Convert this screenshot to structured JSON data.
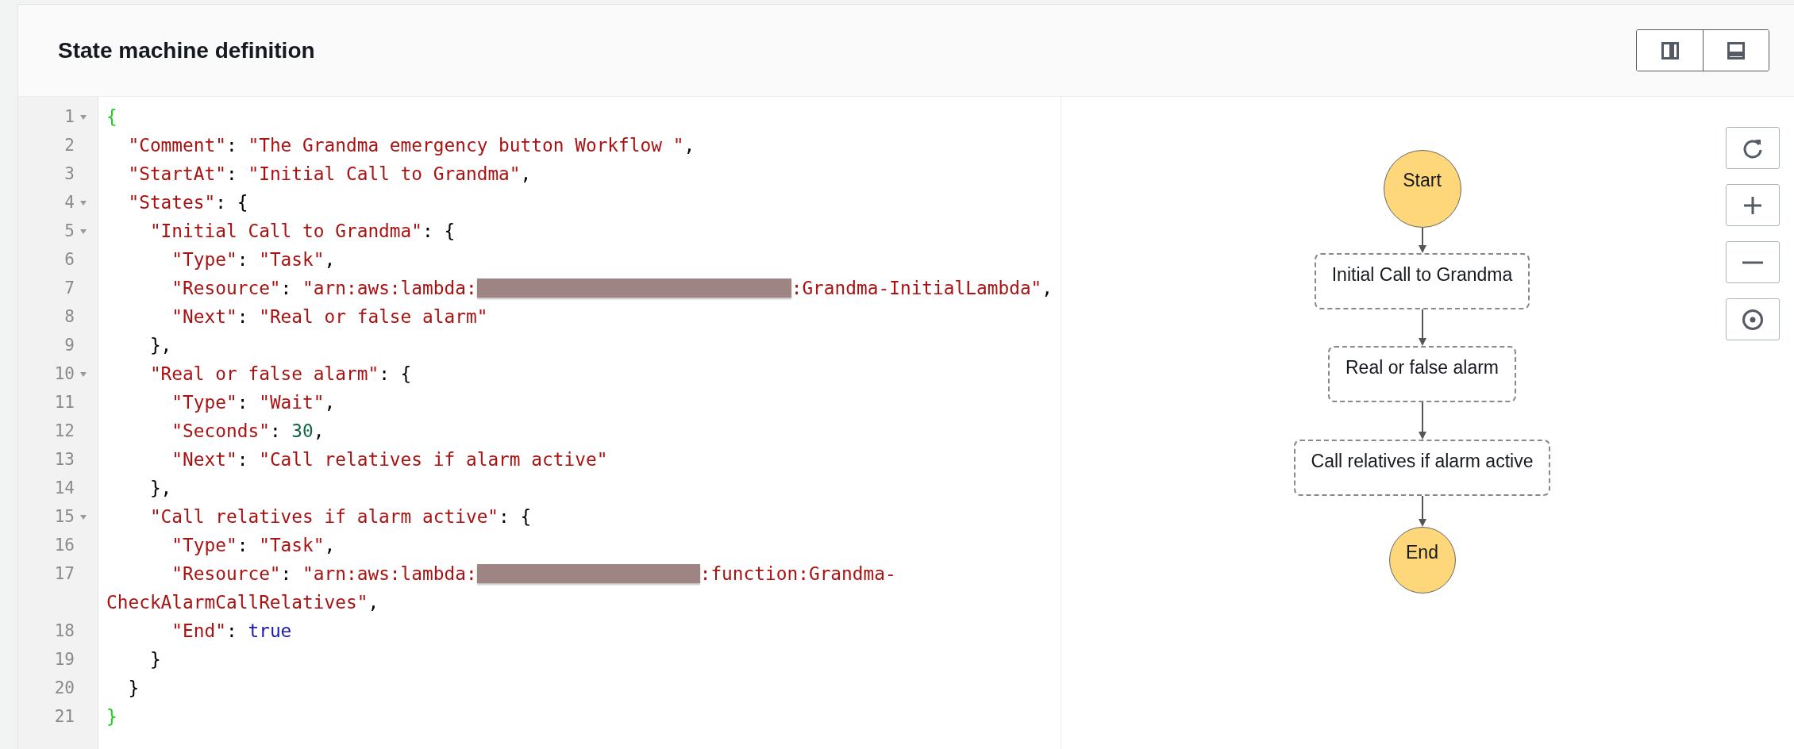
{
  "panel": {
    "title": "State machine definition"
  },
  "layout_buttons": [
    {
      "kind": "columns",
      "selected": false
    },
    {
      "kind": "rows",
      "selected": false
    }
  ],
  "code": {
    "lines": [
      {
        "number": "1",
        "foldable": true,
        "tokens": [
          {
            "kind": "brace",
            "text": "{"
          }
        ]
      },
      {
        "number": "2",
        "foldable": false,
        "tokens": [
          {
            "kind": "string",
            "text": "  \"Comment\""
          },
          {
            "kind": "punct",
            "text": ": "
          },
          {
            "kind": "string",
            "text": "\"The Grandma emergency button Workflow \""
          },
          {
            "kind": "punct",
            "text": ","
          }
        ]
      },
      {
        "number": "3",
        "foldable": false,
        "tokens": [
          {
            "kind": "string",
            "text": "  \"StartAt\""
          },
          {
            "kind": "punct",
            "text": ": "
          },
          {
            "kind": "string",
            "text": "\"Initial Call to Grandma\""
          },
          {
            "kind": "punct",
            "text": ","
          }
        ]
      },
      {
        "number": "4",
        "foldable": true,
        "tokens": [
          {
            "kind": "string",
            "text": "  \"States\""
          },
          {
            "kind": "punct",
            "text": ": {"
          }
        ]
      },
      {
        "number": "5",
        "foldable": true,
        "tokens": [
          {
            "kind": "string",
            "text": "    \"Initial Call to Grandma\""
          },
          {
            "kind": "punct",
            "text": ": {"
          }
        ]
      },
      {
        "number": "6",
        "foldable": false,
        "tokens": [
          {
            "kind": "string",
            "text": "      \"Type\""
          },
          {
            "kind": "punct",
            "text": ": "
          },
          {
            "kind": "string",
            "text": "\"Task\""
          },
          {
            "kind": "punct",
            "text": ","
          }
        ]
      },
      {
        "number": "7",
        "foldable": false,
        "tokens": [
          {
            "kind": "string",
            "text": "      \"Resource\""
          },
          {
            "kind": "punct",
            "text": ": "
          },
          {
            "kind": "string",
            "text": "\"arn:aws:lambda:"
          },
          {
            "kind": "redacted"
          },
          {
            "kind": "string",
            "text": ":Grandma-InitialLambda\""
          },
          {
            "kind": "punct",
            "text": ","
          }
        ]
      },
      {
        "number": "8",
        "foldable": false,
        "tokens": [
          {
            "kind": "string",
            "text": "      \"Next\""
          },
          {
            "kind": "punct",
            "text": ": "
          },
          {
            "kind": "string",
            "text": "\"Real or false alarm\""
          }
        ]
      },
      {
        "number": "9",
        "foldable": false,
        "tokens": [
          {
            "kind": "punct",
            "text": "    },"
          }
        ]
      },
      {
        "number": "10",
        "foldable": true,
        "tokens": [
          {
            "kind": "string",
            "text": "    \"Real or false alarm\""
          },
          {
            "kind": "punct",
            "text": ": {"
          }
        ]
      },
      {
        "number": "11",
        "foldable": false,
        "tokens": [
          {
            "kind": "string",
            "text": "      \"Type\""
          },
          {
            "kind": "punct",
            "text": ": "
          },
          {
            "kind": "string",
            "text": "\"Wait\""
          },
          {
            "kind": "punct",
            "text": ","
          }
        ]
      },
      {
        "number": "12",
        "foldable": false,
        "tokens": [
          {
            "kind": "string",
            "text": "      \"Seconds\""
          },
          {
            "kind": "punct",
            "text": ": "
          },
          {
            "kind": "number",
            "text": "30"
          },
          {
            "kind": "punct",
            "text": ","
          }
        ]
      },
      {
        "number": "13",
        "foldable": false,
        "tokens": [
          {
            "kind": "string",
            "text": "      \"Next\""
          },
          {
            "kind": "punct",
            "text": ": "
          },
          {
            "kind": "string",
            "text": "\"Call relatives if alarm active\""
          }
        ]
      },
      {
        "number": "14",
        "foldable": false,
        "tokens": [
          {
            "kind": "punct",
            "text": "    },"
          }
        ]
      },
      {
        "number": "15",
        "foldable": true,
        "tokens": [
          {
            "kind": "string",
            "text": "    \"Call relatives if alarm active\""
          },
          {
            "kind": "punct",
            "text": ": {"
          }
        ]
      },
      {
        "number": "16",
        "foldable": false,
        "tokens": [
          {
            "kind": "string",
            "text": "      \"Type\""
          },
          {
            "kind": "punct",
            "text": ": "
          },
          {
            "kind": "string",
            "text": "\"Task\""
          },
          {
            "kind": "punct",
            "text": ","
          }
        ]
      },
      {
        "number": "17",
        "foldable": false,
        "tokens": [
          {
            "kind": "string",
            "text": "      \"Resource\""
          },
          {
            "kind": "punct",
            "text": ": "
          },
          {
            "kind": "string",
            "text": "\"arn:aws:lambda:"
          },
          {
            "kind": "redacted"
          },
          {
            "kind": "string",
            "text": ":function:Grandma-"
          },
          {
            "kind": "string",
            "text": "CheckAlarmCallRelatives\""
          },
          {
            "kind": "punct",
            "text": ","
          }
        ]
      },
      {
        "number": "18",
        "foldable": false,
        "tokens": [
          {
            "kind": "string",
            "text": "      \"End\""
          },
          {
            "kind": "punct",
            "text": ": "
          },
          {
            "kind": "boolean",
            "text": "true"
          }
        ]
      },
      {
        "number": "19",
        "foldable": false,
        "tokens": [
          {
            "kind": "punct",
            "text": "    }"
          }
        ]
      },
      {
        "number": "20",
        "foldable": false,
        "tokens": [
          {
            "kind": "punct",
            "text": "  }"
          }
        ]
      },
      {
        "number": "21",
        "foldable": false,
        "tokens": [
          {
            "kind": "brace",
            "text": "}"
          }
        ]
      }
    ]
  },
  "diagram": {
    "nodes": [
      {
        "kind": "terminal",
        "label": "Start"
      },
      {
        "kind": "state",
        "label": "Initial Call to Grandma"
      },
      {
        "kind": "state",
        "label": "Real or false alarm"
      },
      {
        "kind": "state",
        "label": "Call relatives if alarm active"
      },
      {
        "kind": "terminal",
        "label": "End"
      }
    ],
    "controls": [
      {
        "kind": "reset"
      },
      {
        "kind": "zoom_in"
      },
      {
        "kind": "zoom_out"
      },
      {
        "kind": "center"
      }
    ]
  }
}
